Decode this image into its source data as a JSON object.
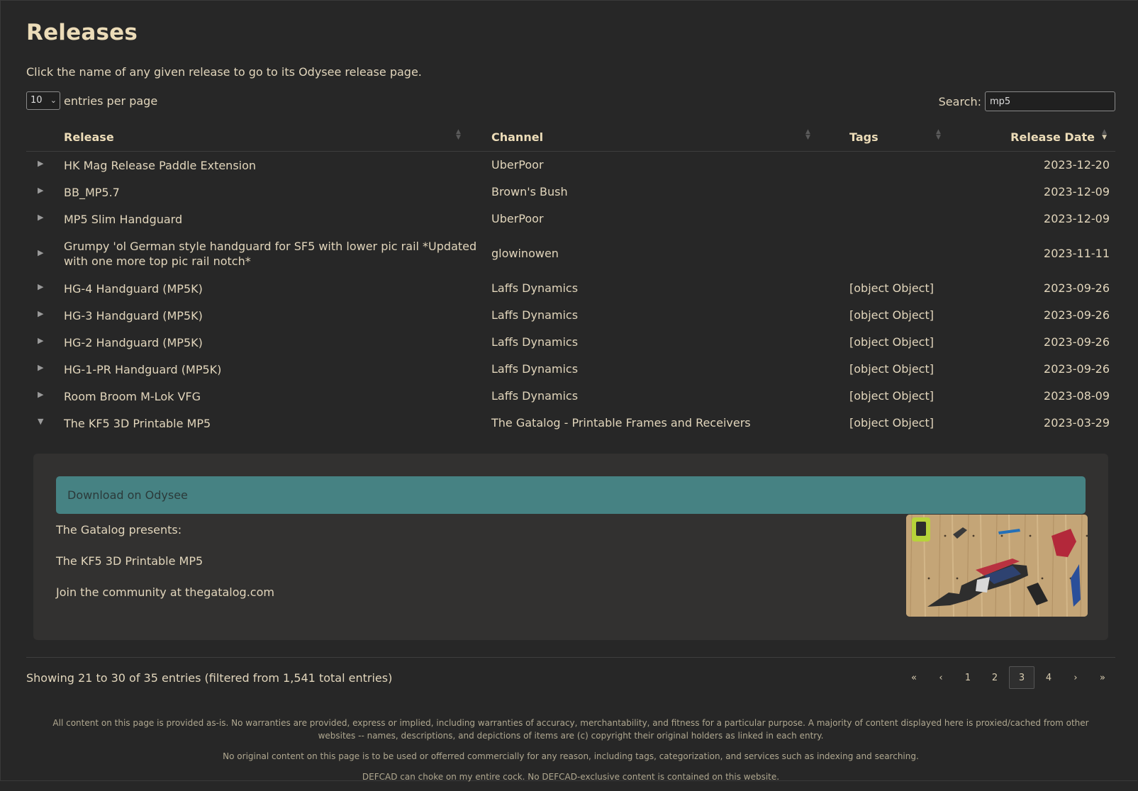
{
  "page": {
    "title": "Releases",
    "intro": "Click the name of any given release to go to its Odysee release page."
  },
  "controls": {
    "length_value": "10",
    "length_suffix": "entries per page",
    "search_label": "Search:",
    "search_value": "mp5"
  },
  "table": {
    "headers": {
      "release": "Release",
      "channel": "Channel",
      "tags": "Tags",
      "date": "Release Date"
    },
    "rows": [
      {
        "toggle": "▶",
        "release": "HK Mag Release Paddle Extension",
        "channel": "UberPoor",
        "tags": "",
        "date": "2023-12-20"
      },
      {
        "toggle": "▶",
        "release": "BB_MP5.7",
        "channel": "Brown's Bush",
        "tags": "",
        "date": "2023-12-09"
      },
      {
        "toggle": "▶",
        "release": "MP5 Slim Handguard",
        "channel": "UberPoor",
        "tags": "",
        "date": "2023-12-09"
      },
      {
        "toggle": "▶",
        "release": "Grumpy 'ol German style handguard for SF5 with lower pic rail *Updated with one more top pic rail notch*",
        "channel": "glowinowen",
        "tags": "",
        "date": "2023-11-11"
      },
      {
        "toggle": "▶",
        "release": "HG-4 Handguard (MP5K)",
        "channel": "Laffs Dynamics",
        "tags": "[object Object]",
        "date": "2023-09-26"
      },
      {
        "toggle": "▶",
        "release": "HG-3 Handguard (MP5K)",
        "channel": "Laffs Dynamics",
        "tags": "[object Object]",
        "date": "2023-09-26"
      },
      {
        "toggle": "▶",
        "release": "HG-2 Handguard (MP5K)",
        "channel": "Laffs Dynamics",
        "tags": "[object Object]",
        "date": "2023-09-26"
      },
      {
        "toggle": "▶",
        "release": "HG-1-PR Handguard (MP5K)",
        "channel": "Laffs Dynamics",
        "tags": "[object Object]",
        "date": "2023-09-26"
      },
      {
        "toggle": "▶",
        "release": "Room Broom M-Lok VFG",
        "channel": "Laffs Dynamics",
        "tags": "[object Object]",
        "date": "2023-08-09"
      },
      {
        "toggle": "▼",
        "release": "The KF5 3D Printable MP5",
        "channel": "The Gatalog - Printable Frames and Receivers",
        "tags": "[object Object]",
        "date": "2023-03-29"
      }
    ]
  },
  "details": {
    "download_label": "Download on Odysee",
    "lines": [
      "The Gatalog presents:",
      "The KF5 3D Printable MP5",
      "Join the community at thegatalog.com"
    ]
  },
  "info": "Showing 21 to 30 of 35 entries (filtered from 1,541 total entries)",
  "pagination": {
    "first": "«",
    "prev": "‹",
    "pages": [
      "1",
      "2",
      "3",
      "4"
    ],
    "current": "3",
    "next": "›",
    "last": "»"
  },
  "footer": [
    "All content on this page is provided as-is. No warranties are provided, express or implied, including warranties of accuracy, merchantability, and fitness for a particular purpose. A majority of content displayed here is proxied/cached from other websites -- names, descriptions, and depictions of items are (c) copyright their original holders as linked in each entry.",
    "No original content on this page is to be used or offerred commercially for any reason, including tags, categorization, and services such as indexing and searching.",
    "DEFCAD can choke on my entire cock. No DEFCAD-exclusive content is contained on this website."
  ],
  "colors": {
    "background": "#272727",
    "text": "#e2d6bc",
    "accent_button": "#468283"
  }
}
